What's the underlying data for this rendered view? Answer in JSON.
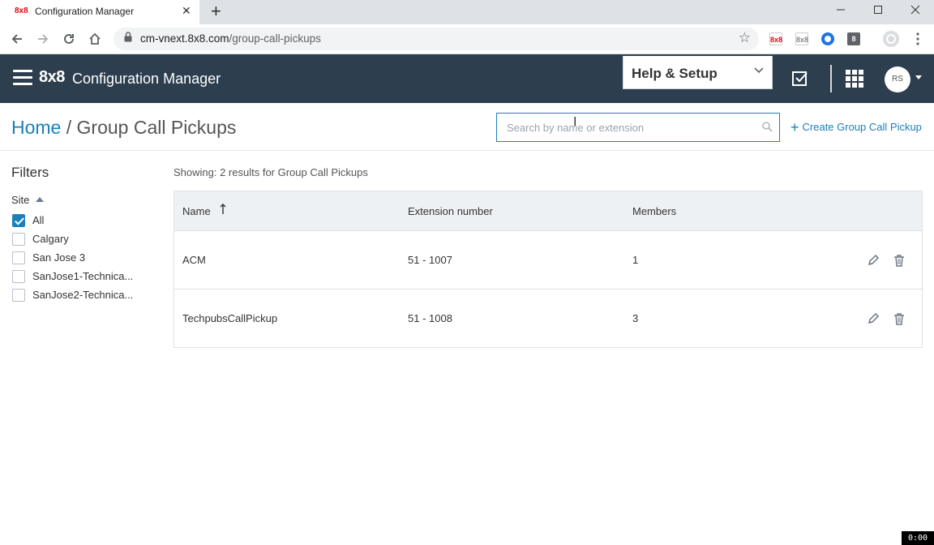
{
  "browser": {
    "tab_favicon": "8x8",
    "tab_title": "Configuration Manager",
    "tab_close": "✕",
    "new_tab": "+",
    "url_host": "cm-vnext.8x8.com",
    "url_path": "/group-call-pickups",
    "extensions": [
      {
        "name": "8x8-extension-icon",
        "text": "8x8",
        "color": "#e30613"
      },
      {
        "name": "8x8-extension-gray-icon",
        "text": "8x8",
        "color": "#888888"
      },
      {
        "name": "circle-extension-icon",
        "text": "",
        "color": "#1a73e8"
      },
      {
        "name": "8-extension-icon",
        "text": "8",
        "color": "#5f6368"
      }
    ]
  },
  "app": {
    "brand_logo": "8x8",
    "title": "Configuration Manager",
    "help_select": "Help & Setup",
    "avatar_initials": "RS"
  },
  "page": {
    "breadcrumb_home": "Home",
    "breadcrumb_sep": "/",
    "breadcrumb_current": "Group Call Pickups",
    "search_placeholder": "Search by name or extension",
    "create_label": "Create Group Call Pickup"
  },
  "filters": {
    "title": "Filters",
    "site_label": "Site",
    "options": [
      {
        "label": "All",
        "checked": true
      },
      {
        "label": "Calgary",
        "checked": false
      },
      {
        "label": "San Jose 3",
        "checked": false
      },
      {
        "label": "SanJose1-Technica...",
        "checked": false
      },
      {
        "label": "SanJose2-Technica...",
        "checked": false
      }
    ]
  },
  "results": {
    "showing_text": "Showing: 2 results for Group Call Pickups",
    "columns": [
      "Name",
      "Extension number",
      "Members"
    ],
    "rows": [
      {
        "name": "ACM",
        "extension": "51 - 1007",
        "members": "1"
      },
      {
        "name": "TechpubsCallPickup",
        "extension": "51 - 1008",
        "members": "3"
      }
    ]
  },
  "clock": "0:00",
  "colors": {
    "appbar": "#2d3e4f",
    "accent": "#1d7fb8"
  }
}
